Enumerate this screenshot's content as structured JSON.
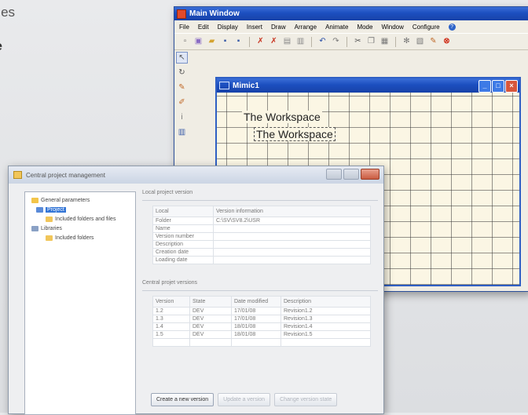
{
  "background": {
    "line1": "modes",
    "line2": "vare"
  },
  "main_window": {
    "title": "Main Window",
    "menu": [
      "File",
      "Edit",
      "Display",
      "Insert",
      "Draw",
      "Arrange",
      "Animate",
      "Mode",
      "Window",
      "Configure"
    ],
    "toolbar_icons": [
      "new-icon",
      "palette-icon",
      "open-icon",
      "save-icon",
      "save-all-icon",
      "cut-red-icon",
      "cut-icon",
      "print-preview-icon",
      "print-icon",
      "undo-icon",
      "redo-icon",
      "scissors-icon",
      "copy-icon",
      "paste-icon",
      "find-icon",
      "format-icon",
      "delete-icon"
    ]
  },
  "mimic": {
    "title": "Mimic1",
    "text1": "The Workspace",
    "text2": "The Workspace"
  },
  "cpm": {
    "title": "Central project management",
    "tree": [
      {
        "label": "General parameters",
        "indent": 0,
        "icon": "gear"
      },
      {
        "label": "Project",
        "indent": 1,
        "icon": "project",
        "selected": true
      },
      {
        "label": "Included folders and files",
        "indent": 2,
        "icon": "folder"
      },
      {
        "label": "Libraries",
        "indent": 0,
        "icon": "library"
      },
      {
        "label": "Included folders",
        "indent": 2,
        "icon": "folder"
      }
    ],
    "local_group": "Local project version",
    "local_headers": [
      "Local",
      "Version information"
    ],
    "local_rows": [
      [
        "Folder",
        "C:\\SV\\SV8.2\\USR"
      ],
      [
        "Name",
        ""
      ],
      [
        "Version number",
        ""
      ],
      [
        "Description",
        ""
      ],
      [
        "Creation date",
        ""
      ],
      [
        "Loading date",
        ""
      ]
    ],
    "central_group": "Central projet versions",
    "central_headers": [
      "Version",
      "State",
      "Date modified",
      "Description"
    ],
    "central_rows": [
      [
        "1.2",
        "DEV",
        "17/01/08",
        "Revision1.2"
      ],
      [
        "1.3",
        "DEV",
        "17/01/08",
        "Revision1.3"
      ],
      [
        "1.4",
        "DEV",
        "18/01/08",
        "Revision1.4"
      ],
      [
        "1.5",
        "DEV",
        "18/01/08",
        "Revision1.5"
      ]
    ],
    "buttons": [
      "Create a new version",
      "Update a version",
      "Change version state"
    ]
  }
}
